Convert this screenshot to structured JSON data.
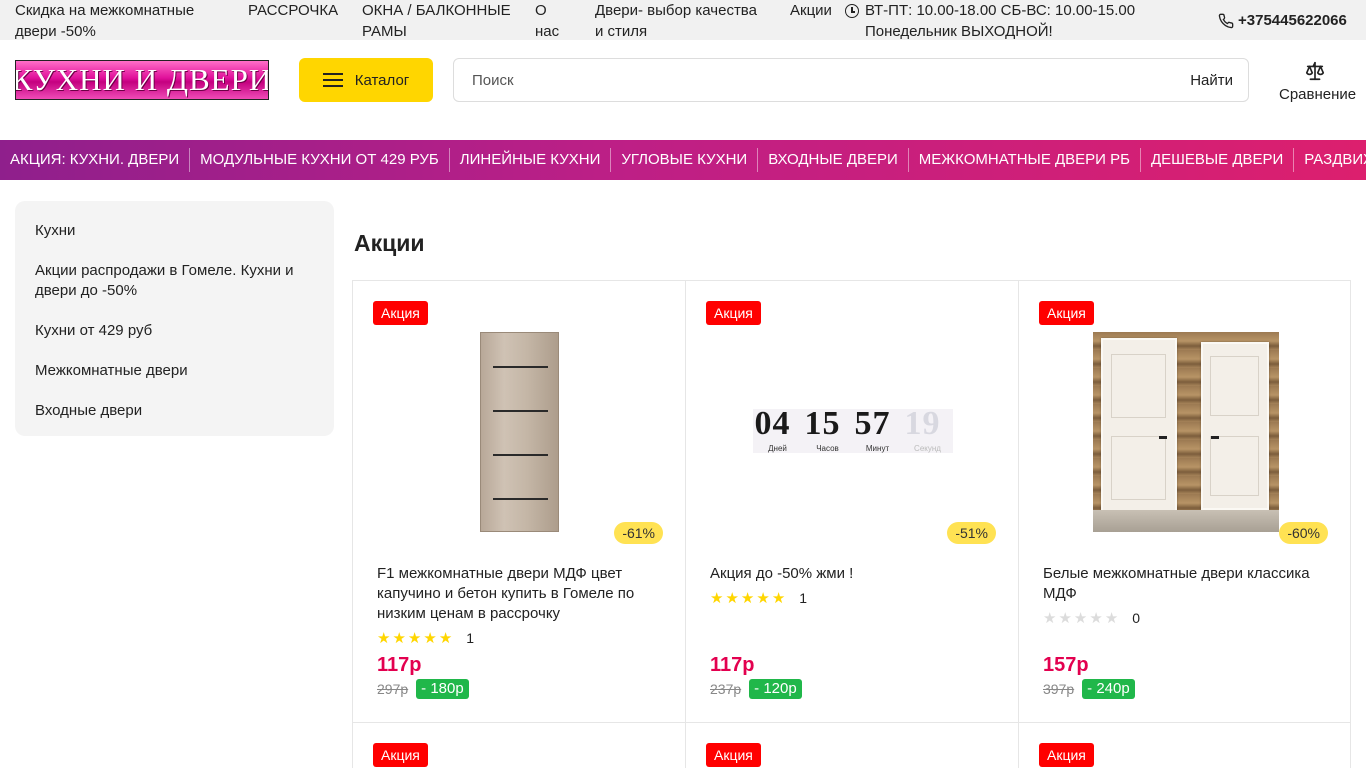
{
  "topbar": {
    "sale_line1": "Скидка на межкомнатные",
    "sale_line2": "двери -50%",
    "installment": "РАССРОЧКА",
    "windows_line1": "ОКНА / БАЛКОННЫЕ",
    "windows_line2": "РАМЫ",
    "about_line1": "О",
    "about_line2": "нас",
    "doors_line1": "Двери- выбор качества",
    "doors_line2": "и стиля",
    "promo": "Акции",
    "hours_line1": "ВТ-ПТ: 10.00-18.00 СБ-ВС: 10.00-15.00",
    "hours_line2": "Понедельник ВЫХОДНОЙ!",
    "phone": "+375445622066"
  },
  "header": {
    "logo_text": "КУХНИ И ДВЕРИ",
    "catalog_label": "Каталог",
    "search_placeholder": "Поиск",
    "search_button": "Найти",
    "compare_label": "Сравнение"
  },
  "nav": {
    "items": [
      "АКЦИЯ: КУХНИ. ДВЕРИ",
      "МОДУЛЬНЫЕ КУХНИ ОТ 429 РУБ",
      "ЛИНЕЙНЫЕ КУХНИ",
      "УГЛОВЫЕ КУХНИ",
      "ВХОДНЫЕ ДВЕРИ",
      "МЕЖКОМНАТНЫЕ ДВЕРИ РБ",
      "ДЕШЕВЫЕ ДВЕРИ",
      "РАЗДВИЖНЫЕ ДВЕРИ"
    ]
  },
  "sidebar": {
    "items": [
      "Кухни",
      "Акции распродажи в Гомеле. Кухни и двери до -50%",
      "Кухни от 429 руб",
      "Межкомнатные двери",
      "Входные двери"
    ]
  },
  "page": {
    "title": "Акции"
  },
  "colors": {
    "accent_yellow": "#ffd600",
    "price_red": "#e3004f",
    "badge_red": "#ff0000",
    "save_green": "#20b74a",
    "nav_start": "#8f1f8c",
    "nav_end": "#dc1f6e"
  },
  "products": [
    {
      "badge": "Акция",
      "discount": "-61%",
      "name": "F1 межкомнатные двери МДФ цвет капучино и бетон купить в Гомеле по низким ценам в рассрочку",
      "rating": 5,
      "reviews": "1",
      "price": "117р",
      "old_price": "297р",
      "save": "- 180р"
    },
    {
      "badge": "Акция",
      "discount": "-51%",
      "name": "Акция до -50% жми !",
      "rating": 5,
      "reviews": "1",
      "price": "117р",
      "old_price": "237р",
      "save": "- 120р",
      "counter": {
        "days": "04",
        "hours": "15",
        "minutes": "57",
        "seconds": "19",
        "days_label": "Дней",
        "hours_label": "Часов",
        "minutes_label": "Минут",
        "seconds_label": "Секунд"
      }
    },
    {
      "badge": "Акция",
      "discount": "-60%",
      "name": "Белые межкомнатные двери классика МДФ",
      "rating": 0,
      "reviews": "0",
      "price": "157р",
      "old_price": "397р",
      "save": "- 240р"
    }
  ],
  "products_row2": [
    {
      "badge": "Акция"
    },
    {
      "badge": "Акция"
    },
    {
      "badge": "Акция"
    }
  ]
}
